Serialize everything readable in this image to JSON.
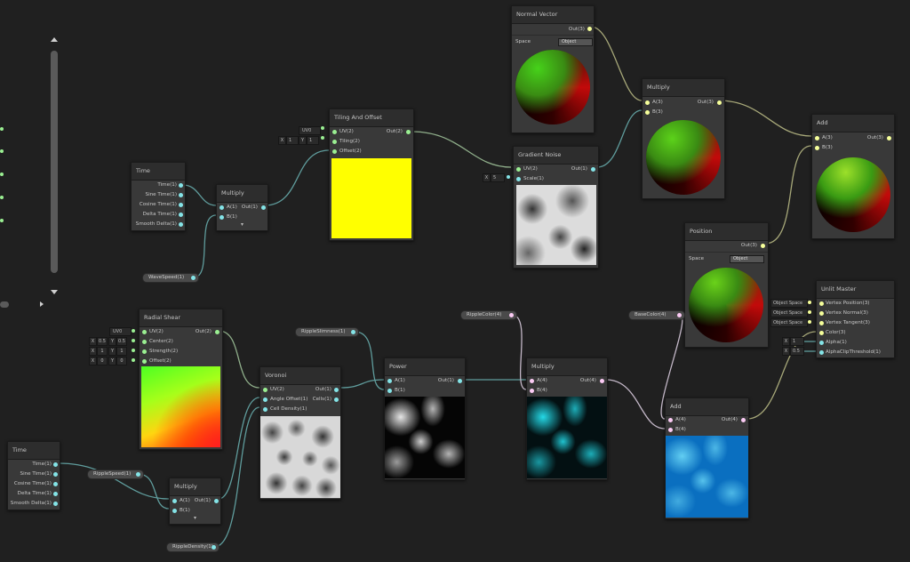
{
  "nodes": {
    "normal_vector": {
      "title": "Normal Vector",
      "out": "Out(3)",
      "space_label": "Space",
      "space_value": "Object"
    },
    "multiply_top": {
      "title": "Multiply",
      "in_a": "A(3)",
      "in_b": "B(3)",
      "out": "Out(3)"
    },
    "add_top": {
      "title": "Add",
      "in_a": "A(3)",
      "in_b": "B(3)",
      "out": "Out(3)"
    },
    "tiling": {
      "title": "Tiling And Offset",
      "uv": "UV(2)",
      "tiling": "Tiling(2)",
      "offset": "Offset(2)",
      "out": "Out(2)",
      "uv_value": "UV0",
      "x_label": "X",
      "x_value": "1",
      "y_label": "Y",
      "y_value": "1"
    },
    "time_top": {
      "title": "Time",
      "outputs": [
        "Time(1)",
        "Sine Time(1)",
        "Cosine Time(1)",
        "Delta Time(1)",
        "Smooth Delta(1)"
      ]
    },
    "multiply_left": {
      "title": "Multiply",
      "in_a": "A(1)",
      "in_b": "B(1)",
      "out": "Out(1)"
    },
    "gradient_noise": {
      "title": "Gradient Noise",
      "uv": "UV(2)",
      "scale": "Scale(1)",
      "out": "Out(1)",
      "x_label": "X",
      "x_value": "5"
    },
    "position": {
      "title": "Position",
      "out": "Out(3)",
      "space_label": "Space",
      "space_value": "Object"
    },
    "unlit_master": {
      "title": "Unlit Master",
      "inputs": [
        "Vertex Position(3)",
        "Vertex Normal(3)",
        "Vertex Tangent(3)",
        "Color(3)",
        "Alpha(1)",
        "AlphaClipThreshold(1)"
      ],
      "space_boxes": [
        "Object Space",
        "Object Space",
        "Object Space"
      ],
      "alpha_x": "X",
      "alpha_value": "1",
      "clip_x": "X",
      "clip_value": "0.5"
    },
    "radial_shear": {
      "title": "Radial Shear",
      "inputs": [
        "UV(2)",
        "Center(2)",
        "Strength(2)",
        "Offset(2)"
      ],
      "out": "Out(2)",
      "uv_value": "UV0",
      "center": [
        "X",
        "0.5",
        "Y",
        "0.5"
      ],
      "strength": [
        "X",
        "1",
        "Y",
        "1"
      ],
      "offset": [
        "X",
        "0",
        "Y",
        "0"
      ]
    },
    "voronoi": {
      "title": "Voronoi",
      "inputs": [
        "UV(2)",
        "Angle Offset(1)",
        "Cell Density(1)"
      ],
      "outputs": [
        "Out(1)",
        "Cells(1)"
      ]
    },
    "power": {
      "title": "Power",
      "in_a": "A(1)",
      "in_b": "B(1)",
      "out": "Out(1)"
    },
    "multiply_mid": {
      "title": "Multiply",
      "in_a": "A(4)",
      "in_b": "B(4)",
      "out": "Out(4)"
    },
    "add_bottom": {
      "title": "Add",
      "in_a": "A(4)",
      "in_b": "B(4)",
      "out": "Out(4)"
    },
    "time_bottom": {
      "title": "Time",
      "outputs": [
        "Time(1)",
        "Sine Time(1)",
        "Cosine Time(1)",
        "Delta Time(1)",
        "Smooth Delta(1)"
      ]
    },
    "multiply_bottom": {
      "title": "Multiply",
      "in_a": "A(1)",
      "in_b": "B(1)",
      "out": "Out(1)"
    }
  },
  "properties": {
    "wave_speed": "WaveSpeed(1)",
    "ripple_slimness": "RippleSlimness(1)",
    "ripple_color": "RippleColor(4)",
    "base_color": "BaseColor(4)",
    "ripple_speed": "RippleSpeed(1)",
    "ripple_density": "RippleDensity(1)"
  },
  "colors": {
    "background": "#202020",
    "wire": "#8a8f6a",
    "wire_teal": "#5a9a9a",
    "port_float": "#84e4e7",
    "port_vec2": "#9aef92",
    "port_vec3": "#f6ff9a",
    "port_vec4": "#fbcbf4",
    "node_body": "#393939",
    "node_header": "#2d2d2d"
  }
}
